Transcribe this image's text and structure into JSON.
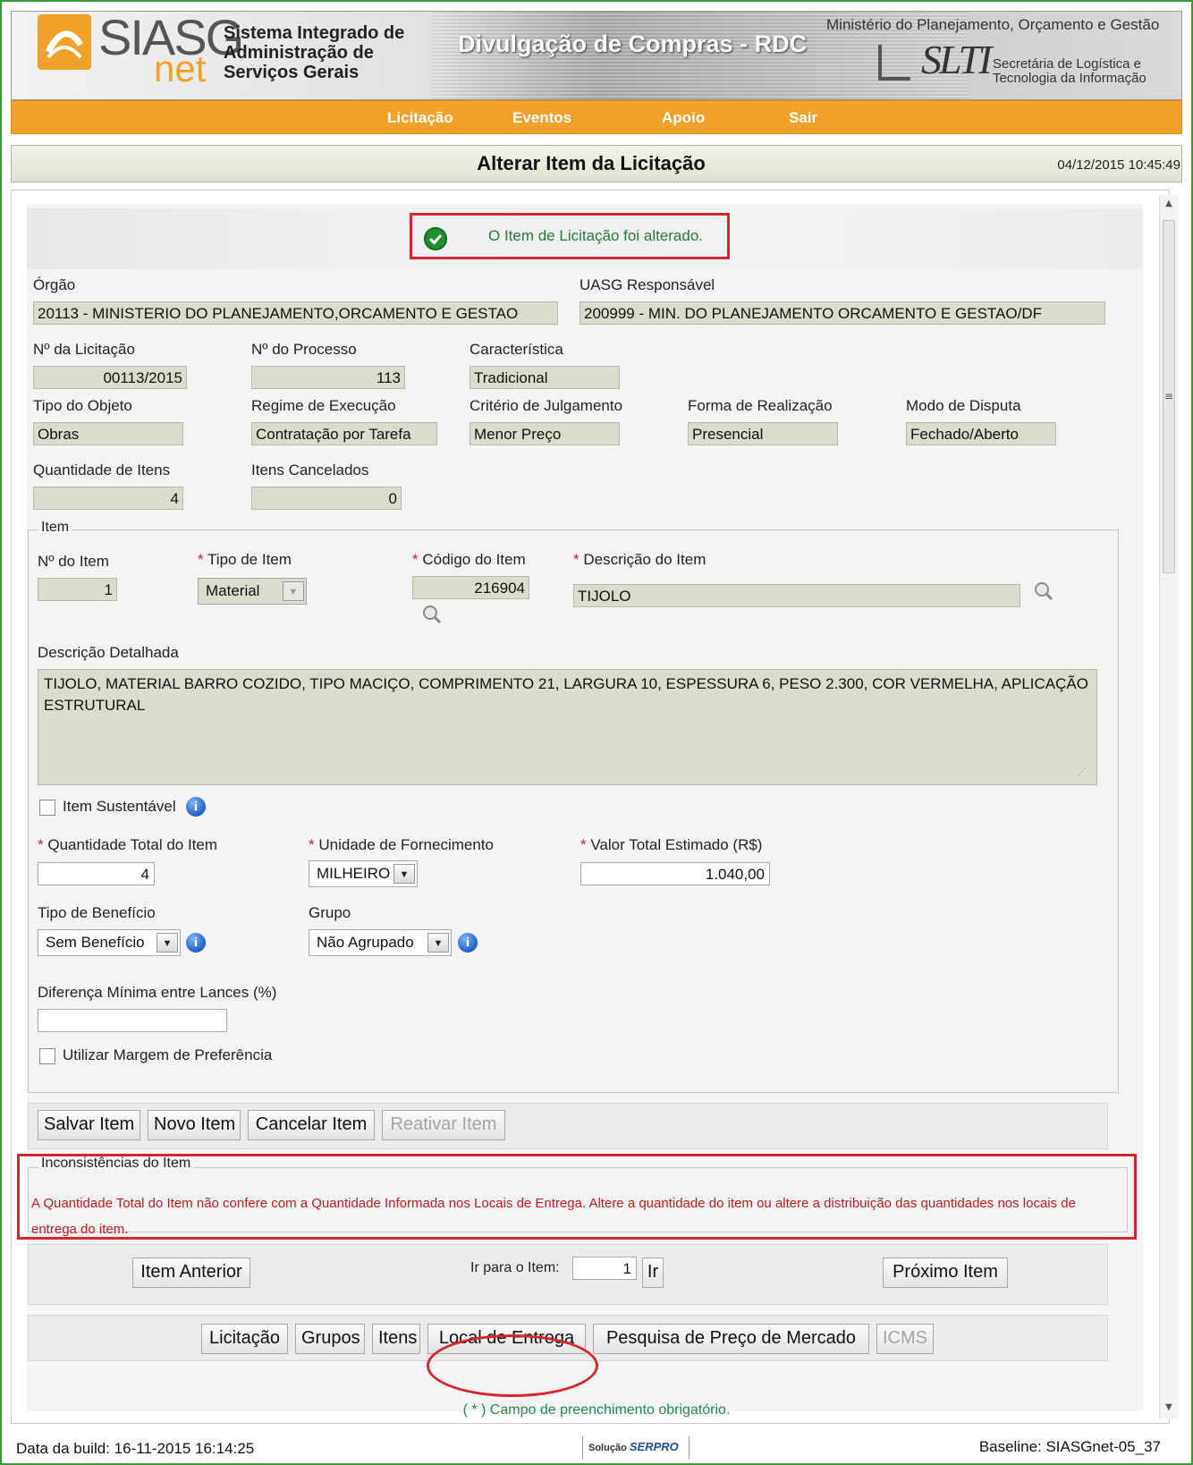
{
  "header": {
    "system_line1": "Sistema Integrado de",
    "system_line2": "Administração de",
    "system_line3": "Serviços Gerais",
    "logo_main": "SIASG",
    "logo_sub": "net",
    "module_title": "Divulgação de Compras - RDC",
    "ministry": "Ministério do Planejamento, Orçamento e Gestão",
    "slti_logo": "SLTI",
    "slti_line1": "Secretária de Logística e",
    "slti_line2": "Tecnologia da Informação"
  },
  "menu": {
    "items": [
      "Licitação",
      "Eventos",
      "Apoio",
      "Sair"
    ]
  },
  "page": {
    "title": "Alterar Item da Licitação",
    "datetime": "04/12/2015 10:45:49",
    "success_message": "O Item de Licitação foi alterado."
  },
  "licitacao": {
    "orgao_label": "Órgão",
    "orgao_value": "20113 - MINISTERIO DO PLANEJAMENTO,ORCAMENTO E GESTAO",
    "uasg_label": "UASG Responsável",
    "uasg_value": "200999 - MIN. DO PLANEJAMENTO ORCAMENTO E GESTAO/DF",
    "numero_label": "Nº da Licitação",
    "numero_value": "00113/2015",
    "processo_label": "Nº do Processo",
    "processo_value": "113",
    "caracteristica_label": "Característica",
    "caracteristica_value": "Tradicional",
    "tipo_objeto_label": "Tipo do Objeto",
    "tipo_objeto_value": "Obras",
    "regime_label": "Regime de Execução",
    "regime_value": "Contratação por Tarefa",
    "criterio_label": "Critério de Julgamento",
    "criterio_value": "Menor Preço",
    "forma_label": "Forma de Realização",
    "forma_value": "Presencial",
    "modo_label": "Modo de Disputa",
    "modo_value": "Fechado/Aberto",
    "qtd_itens_label": "Quantidade de Itens",
    "qtd_itens_value": "4",
    "itens_cancelados_label": "Itens Cancelados",
    "itens_cancelados_value": "0"
  },
  "item": {
    "legend": "Item",
    "numero_label": "Nº do Item",
    "numero_value": "1",
    "tipo_label": "Tipo de Item",
    "tipo_value": "Material",
    "codigo_label": "Código do Item",
    "codigo_value": "216904",
    "descricao_label": "Descrição do Item",
    "descricao_value": "TIJOLO",
    "descricao_detalhada_label": "Descrição Detalhada",
    "descricao_detalhada_value": "TIJOLO, MATERIAL BARRO COZIDO, TIPO MACIÇO, COMPRIMENTO 21, LARGURA 10, ESPESSURA 6, PESO 2.300, COR VERMELHA, APLICAÇÃO ESTRUTURAL",
    "sustentavel_label": "Item Sustentável",
    "quantidade_label": "Quantidade Total do Item",
    "quantidade_value": "4",
    "unidade_label": "Unidade de Fornecimento",
    "unidade_value": "MILHEIRO",
    "valor_label": "Valor Total Estimado (R$)",
    "valor_value": "1.040,00",
    "beneficio_label": "Tipo de Benefício",
    "beneficio_value": "Sem Benefício",
    "grupo_label": "Grupo",
    "grupo_value": "Não Agrupado",
    "diferenca_label": "Diferença Mínima entre Lances (%)",
    "diferenca_value": "",
    "margem_label": "Utilizar Margem de Preferência",
    "required_mark": "*"
  },
  "actions": {
    "salvar": "Salvar Item",
    "novo": "Novo Item",
    "cancelar": "Cancelar Item",
    "reativar": "Reativar Item"
  },
  "inconsistencias": {
    "legend": "Inconsistências do Item",
    "message": "A Quantidade Total do Item não confere com a Quantidade Informada nos Locais de Entrega. Altere a quantidade do item ou altere a distribuição das quantidades nos locais de entrega do item."
  },
  "navigation": {
    "anterior": "Item Anterior",
    "ir_para_label": "Ir para o Item:",
    "ir_para_value": "1",
    "ir": "Ir",
    "proximo": "Próximo Item"
  },
  "tabs": {
    "licitacao": "Licitação",
    "grupos": "Grupos",
    "itens": "Itens",
    "local_entrega": "Local de Entrega",
    "pesquisa_preco": "Pesquisa de Preço de Mercado",
    "icms": "ICMS"
  },
  "footer": {
    "required_note": "( * ) Campo de preenchimento obrigatório.",
    "build_date": "Data da build: 16-11-2015 16:14:25",
    "serpro_prefix": "Solução",
    "serpro": "SERPRO",
    "baseline": "Baseline: SIASGnet-05_37"
  },
  "colors": {
    "menu_orange": "#f0a12a",
    "highlight_red": "#d7262b",
    "success_green": "#237c3c",
    "error_red": "#c41a1a",
    "readonly_bg": "#dcdccc",
    "frame_green": "#3a9a3a"
  }
}
